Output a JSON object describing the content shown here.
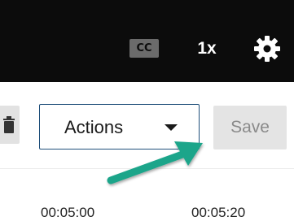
{
  "player": {
    "cc_label": "CC",
    "speed_label": "1x",
    "icons": {
      "captions": "closed-captions-icon",
      "settings": "gear-icon"
    }
  },
  "toolbar": {
    "actions_label": "Actions",
    "save_label": "Save",
    "icons": {
      "delete": "trash-icon",
      "dropdown": "chevron-down-icon"
    }
  },
  "timeline": {
    "timestamps": [
      "00:05:00",
      "00:05:20"
    ]
  },
  "annotation": {
    "arrow_color": "#1aa58a",
    "arrow_icon": "arrow-icon"
  },
  "colors": {
    "player_bg": "#0c0c0c",
    "dropdown_border": "#1f4f7a",
    "save_bg": "#e4e4e4"
  }
}
